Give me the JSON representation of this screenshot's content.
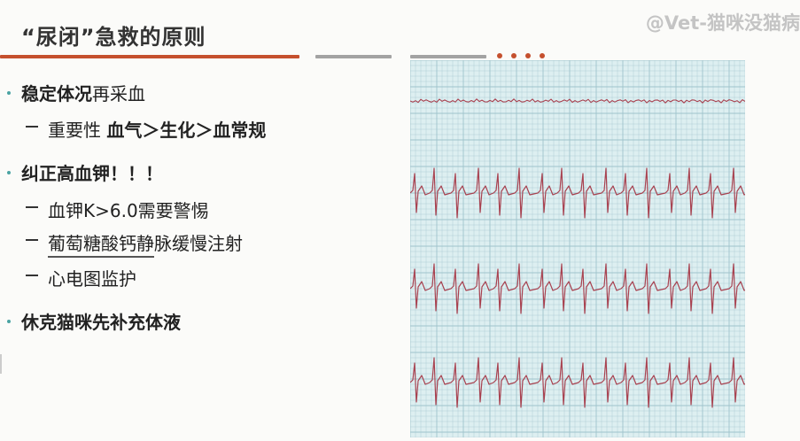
{
  "slide": {
    "title": "“尿闭”急救的原则",
    "watermark": "@Vet-猫咪没猫病"
  },
  "bullets": [
    {
      "heading_bold": "稳定体况",
      "heading_rest": "再采血",
      "subitems": [
        {
          "text_regular": "重要性 ",
          "text_bold": "血气＞生化＞血常规"
        }
      ]
    },
    {
      "heading_bold": "纠正高血钾！！！",
      "heading_rest": "",
      "subitems": [
        {
          "text_regular": "血钾K>6.0需要警惕",
          "text_bold": ""
        },
        {
          "text_regular": "葡萄糖酸钙静脉缓慢注射",
          "text_bold": ""
        },
        {
          "text_regular": "心电图监护",
          "text_bold": ""
        }
      ]
    },
    {
      "heading_bold": "休克猫咪先补充体液",
      "heading_rest": "",
      "subitems": []
    }
  ],
  "colors": {
    "accent": "#c5502e",
    "bullet": "#4aa3a3",
    "ecg_trace": "#a8414f",
    "ecg_grid": "#9fc3cc",
    "ecg_paper": "#ddeff1"
  }
}
